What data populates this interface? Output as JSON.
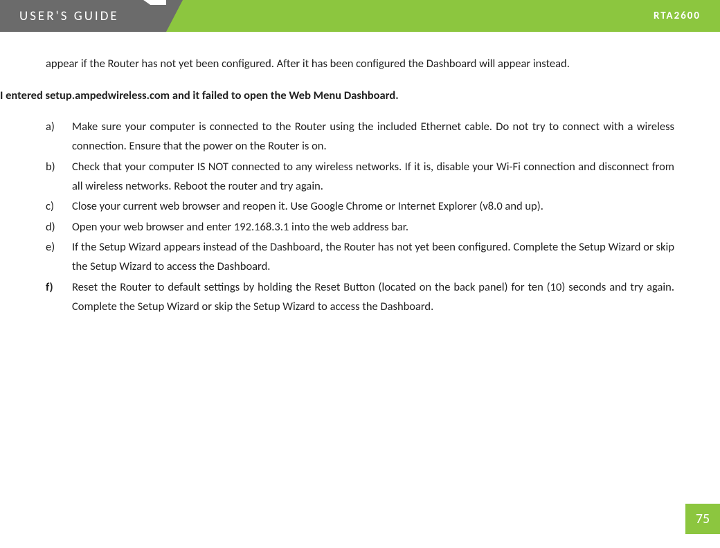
{
  "header": {
    "title_left": "USER'S GUIDE",
    "title_right": "RTA2600"
  },
  "intro_paragraph": "appear if the Router has not yet been configured.  After it has been configured the Dashboard will appear instead.",
  "section_heading": "I entered setup.ampedwireless.com and it failed to open the Web Menu Dashboard.",
  "list_items": [
    {
      "marker": "a)",
      "bold": false,
      "text": "Make sure your computer is connected to the Router using the included Ethernet cable. Do not try to connect with a wireless connection. Ensure that the power on the Router is on."
    },
    {
      "marker": "b)",
      "bold": false,
      "text": "Check that your computer IS NOT connected to any wireless networks. If it is, disable your Wi-Fi connection and disconnect from all wireless networks. Reboot the router and try again."
    },
    {
      "marker": "c)",
      "bold": false,
      "text": "Close your current web browser and reopen it.  Use Google Chrome or Internet Explorer (v8.0 and up)."
    },
    {
      "marker": "d)",
      "bold": false,
      "text": "Open your web browser and enter 192.168.3.1 into the web address bar."
    },
    {
      "marker": "e)",
      "bold": false,
      "text": "If the Setup Wizard appears instead of the Dashboard, the Router has not yet been configured. Complete the Setup Wizard or skip the Setup Wizard to access the Dashboard."
    },
    {
      "marker": "f)",
      "bold": true,
      "text": "Reset the Router to default settings by holding the Reset Button (located on the back panel) for ten (10) seconds and try again.  Complete the Setup Wizard or skip the Setup Wizard to access the Dashboard."
    }
  ],
  "page_number": "75"
}
